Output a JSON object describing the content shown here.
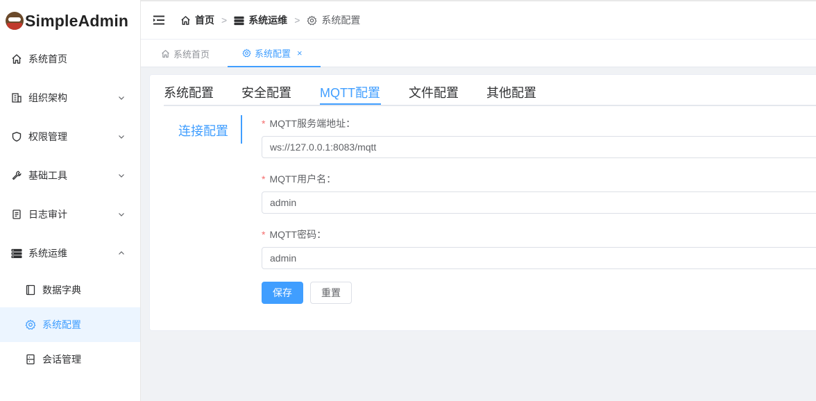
{
  "app": {
    "title": "SimpleAdmin"
  },
  "sidebar": {
    "items": [
      {
        "label": "系统首页",
        "icon": "home-icon"
      },
      {
        "label": "组织架构",
        "icon": "building-icon"
      },
      {
        "label": "权限管理",
        "icon": "shield-icon"
      },
      {
        "label": "基础工具",
        "icon": "wrench-icon"
      },
      {
        "label": "日志审计",
        "icon": "document-icon"
      },
      {
        "label": "系统运维",
        "icon": "server-icon",
        "expanded": true
      }
    ],
    "subitems": [
      {
        "label": "数据字典",
        "icon": "book-icon"
      },
      {
        "label": "系统配置",
        "icon": "gear-icon",
        "active": true
      },
      {
        "label": "会话管理",
        "icon": "session-icon"
      }
    ]
  },
  "breadcrumb": {
    "items": [
      "首页",
      "系统运维",
      "系统配置"
    ],
    "separator": ">"
  },
  "tags": {
    "items": [
      {
        "label": "系统首页",
        "active": false
      },
      {
        "label": "系统配置",
        "active": true,
        "close": "×"
      }
    ]
  },
  "config": {
    "tabs": [
      "系统配置",
      "安全配置",
      "MQTT配置",
      "文件配置",
      "其他配置"
    ],
    "active_tab": "MQTT配置",
    "section_tab": "连接配置",
    "fields": [
      {
        "label": "MQTT服务端地址：",
        "required": true,
        "value": "ws://127.0.0.1:8083/mqtt"
      },
      {
        "label": "MQTT用户名：",
        "required": true,
        "value": "admin"
      },
      {
        "label": "MQTT密码：",
        "required": true,
        "value": "admin"
      }
    ],
    "required_mark": "*",
    "save_label": "保存",
    "reset_label": "重置"
  },
  "colors": {
    "accent": "#409eff",
    "required": "#f56c6c",
    "active_bg": "#ecf5ff"
  }
}
